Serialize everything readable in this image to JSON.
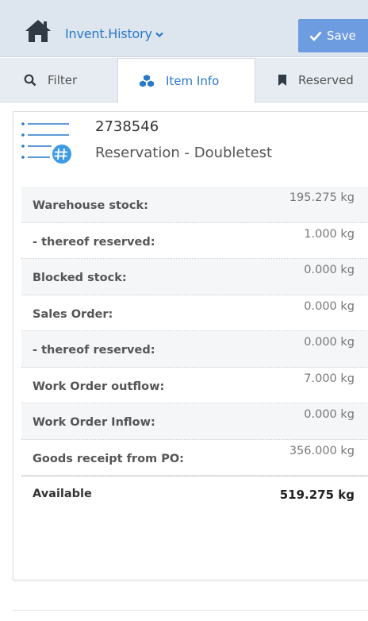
{
  "header": {
    "history_label": "Invent.History",
    "save_label": "Save"
  },
  "tabs": [
    {
      "label": "Filter",
      "icon": "search-icon"
    },
    {
      "label": "Item Info",
      "icon": "cubes-icon"
    },
    {
      "label": "Reserved",
      "icon": "bookmark-icon"
    }
  ],
  "item": {
    "number": "2738546",
    "name": "Reservation - Doubletest"
  },
  "stock_rows": [
    {
      "label": "Warehouse stock:",
      "value": "195.275 kg"
    },
    {
      "label": "- thereof reserved:",
      "value": "1.000 kg"
    },
    {
      "label": "Blocked stock:",
      "value": "0.000 kg"
    },
    {
      "label": "Sales Order:",
      "value": "0.000 kg"
    },
    {
      "label": "- thereof reserved:",
      "value": "0.000 kg"
    },
    {
      "label": "Work Order outflow:",
      "value": "7.000 kg"
    },
    {
      "label": "Work Order Inflow:",
      "value": "0.000 kg"
    },
    {
      "label": "Goods receipt from PO:",
      "value": "356.000 kg"
    }
  ],
  "total": {
    "label": "Available",
    "value": "519.275 kg"
  },
  "colors": {
    "accent": "#2a78c8",
    "save_button": "#6e9ce0",
    "header_bg": "#dde5ee"
  }
}
